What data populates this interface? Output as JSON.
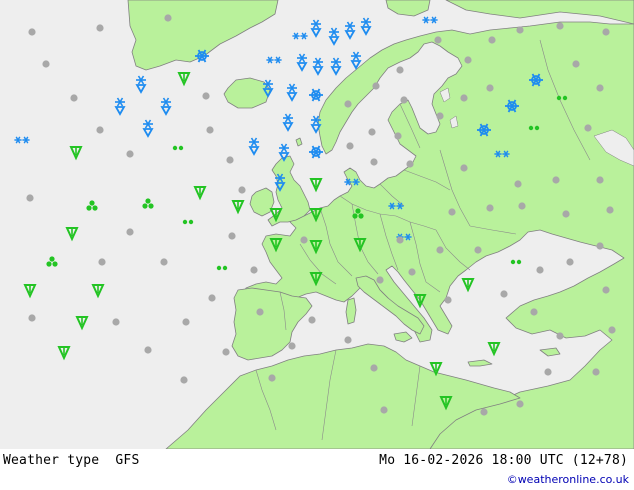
{
  "footer": {
    "product": "Weather type",
    "model": "GFS",
    "valid_time": "Mo 16-02-2026 18:00 UTC (12+78)",
    "credit": "©weatheronline.co.uk"
  },
  "colors": {
    "sea": "#eeeeee",
    "land": "#b9f19b",
    "land_border": "#808080",
    "rain": "#23c423",
    "snow": "#1e8cf0",
    "dry": "#a8a8a8"
  },
  "legend_symbols": {
    "rain": "drop-arrow-icon",
    "showers": "shower-cloud-icon",
    "drizzle": "double-dot-icon",
    "snow": "snowflake-icon",
    "dry": "grey-dot-icon"
  }
}
